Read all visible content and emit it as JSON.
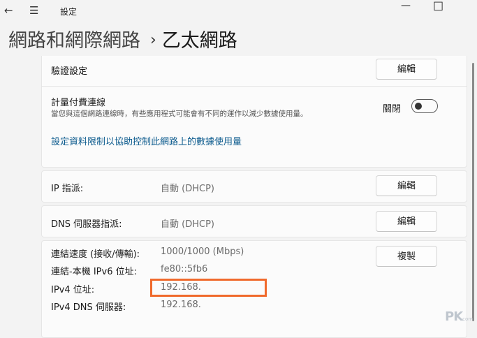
{
  "window": {
    "title": "設定",
    "back_icon": "back-arrow-icon",
    "menu_icon": "hamburger-menu-icon",
    "minimize": "—",
    "maximize": "□"
  },
  "breadcrumb": {
    "parent": "網路和網際網路",
    "separator": "›",
    "current": "乙太網路"
  },
  "auth": {
    "label": "驗證設定",
    "button": "編輯"
  },
  "metered": {
    "label": "計量付費連線",
    "description": "當您與這個網路連線時，有些應用程式可能會有不同的運作以減少數據使用量。",
    "toggle_label": "關閉",
    "toggle_on": false,
    "data_limit_link": "設定資料限制以協助控制此網路上的數據使用量"
  },
  "ip_assignment": {
    "label": "IP 指派:",
    "value": "自動 (DHCP)",
    "button": "編輯"
  },
  "dns_assignment": {
    "label": "DNS 伺服器指派:",
    "value": "自動 (DHCP)",
    "button": "編輯"
  },
  "properties": {
    "copy_button": "複製",
    "rows": [
      {
        "label": "連結速度 (接收/傳輸):",
        "value": "1000/1000 (Mbps)"
      },
      {
        "label": "連結-本機 IPv6 位址:",
        "value": "fe80::5fb6"
      },
      {
        "label": "IPv4 位址:",
        "value": "192.168."
      },
      {
        "label": "IPv4 DNS 伺服器:",
        "value": "192.168."
      }
    ]
  },
  "highlight_color": "#f06a2c",
  "watermark": {
    "text": "PK",
    "small": "com"
  }
}
